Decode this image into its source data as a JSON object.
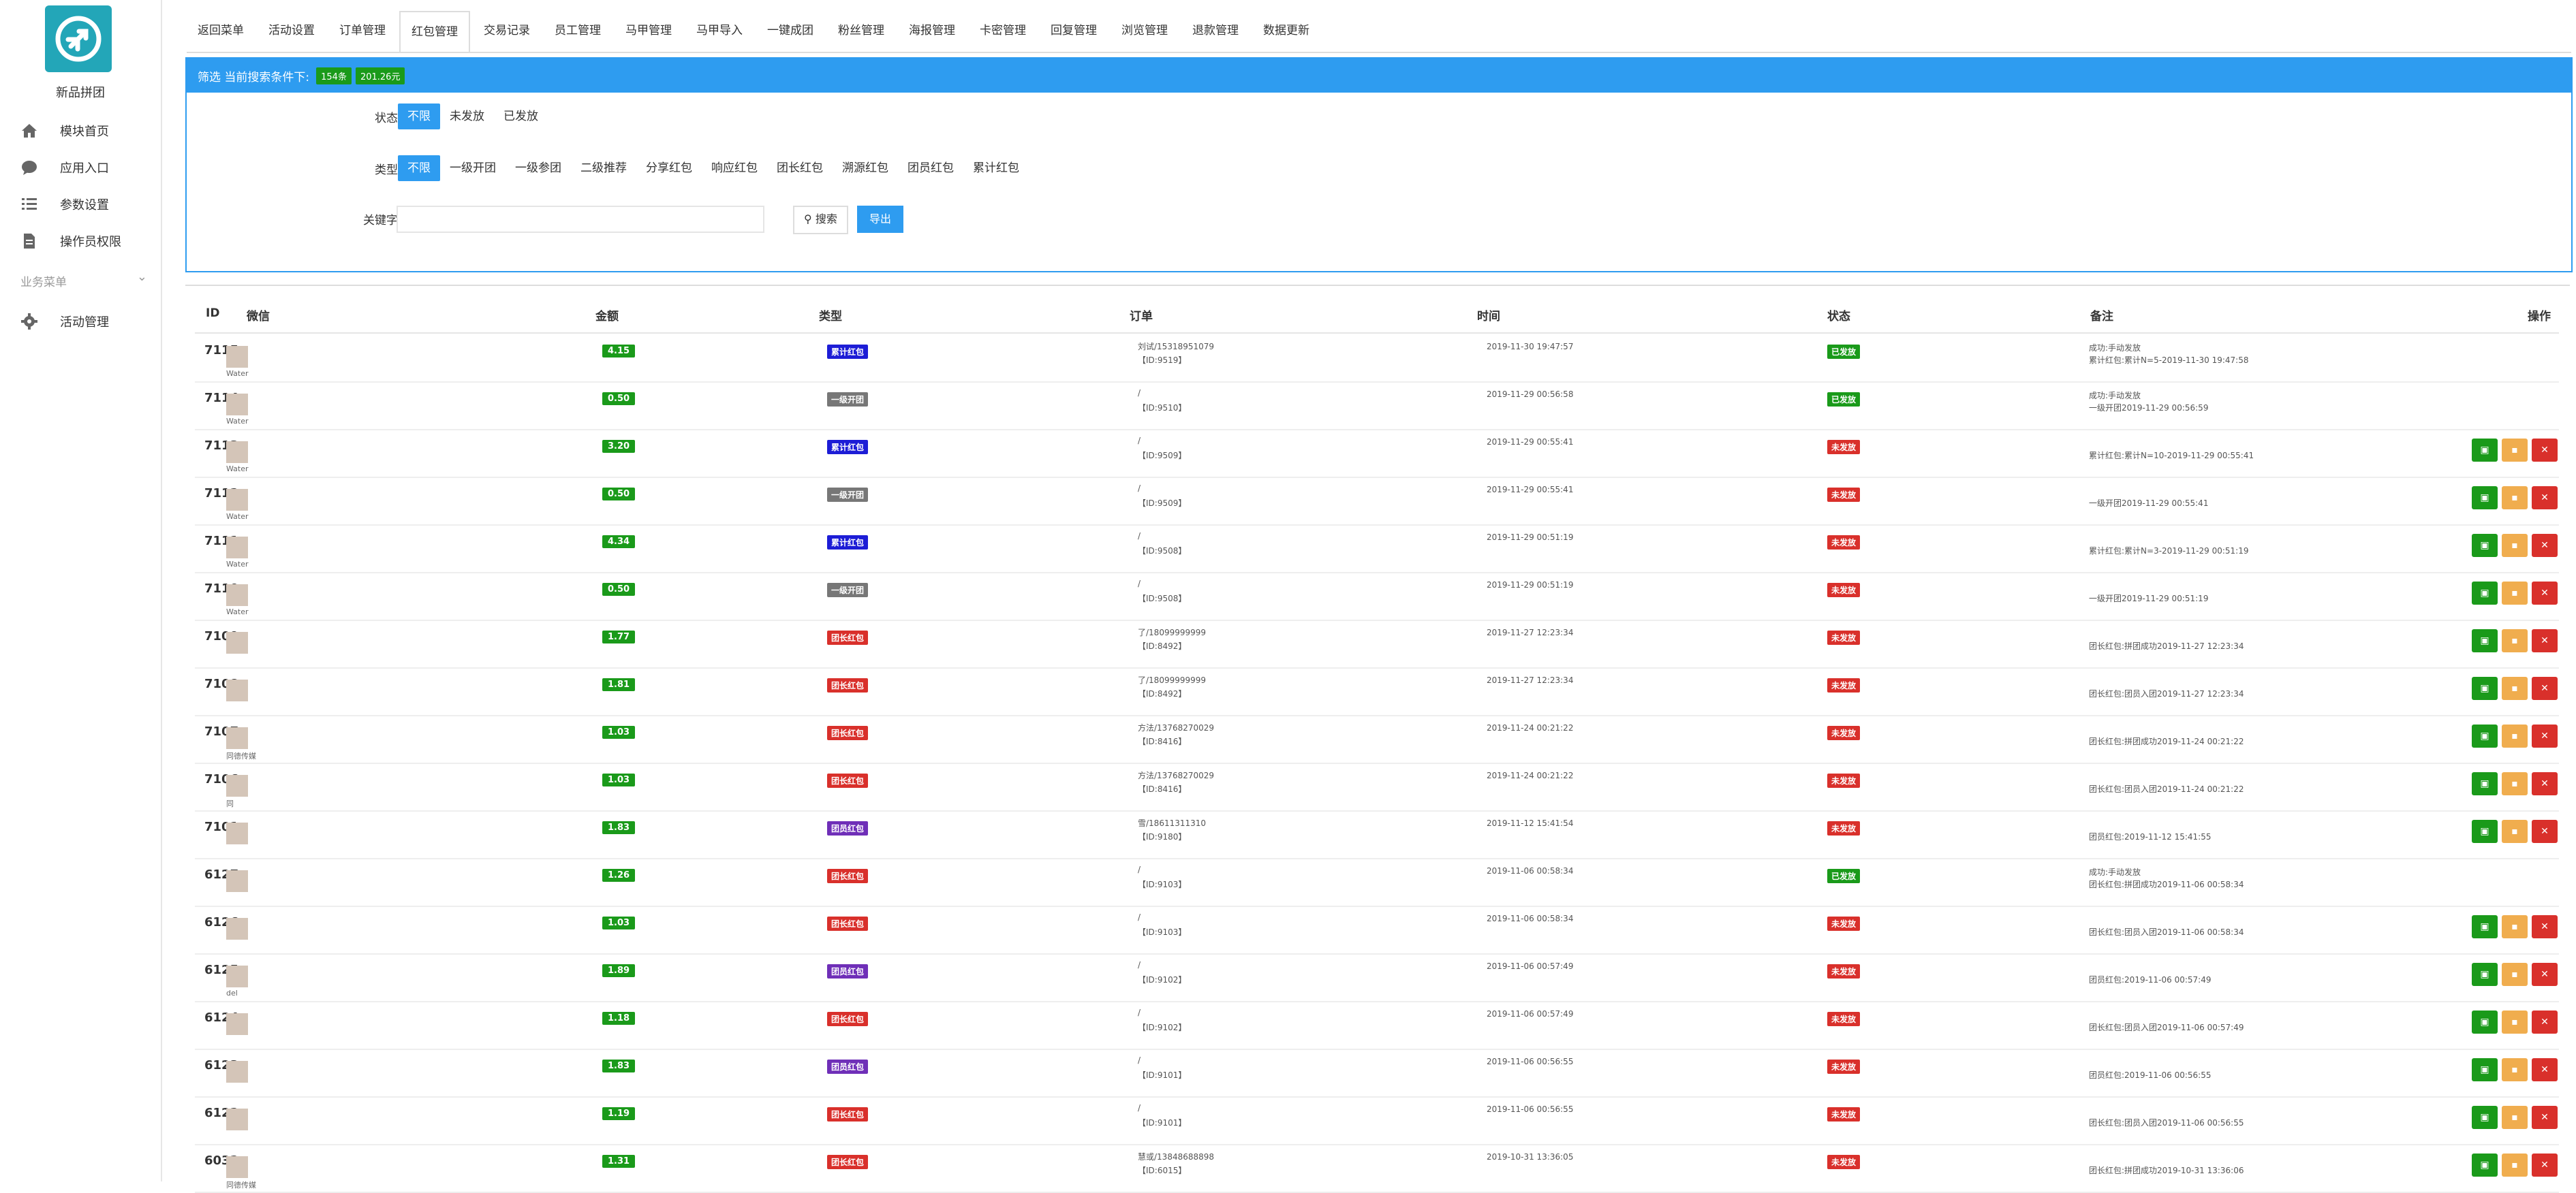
{
  "sidebar": {
    "brand": "新品拼团",
    "items": [
      {
        "label": "模块首页",
        "icon": "home-icon"
      },
      {
        "label": "应用入口",
        "icon": "chat-icon"
      },
      {
        "label": "参数设置",
        "icon": "list-icon"
      },
      {
        "label": "操作员权限",
        "icon": "document-icon"
      }
    ],
    "group_label": "业务菜单",
    "group_items": [
      {
        "label": "活动管理",
        "icon": "gear-icon"
      }
    ]
  },
  "tabs": [
    "返回菜单",
    "活动设置",
    "订单管理",
    "红包管理",
    "交易记录",
    "员工管理",
    "马甲管理",
    "马甲导入",
    "一键成团",
    "粉丝管理",
    "海报管理",
    "卡密管理",
    "回复管理",
    "浏览管理",
    "退款管理",
    "数据更新"
  ],
  "active_tab": "红包管理",
  "filter": {
    "header": "筛选 当前搜索条件下:",
    "count_badge": "154条",
    "sum_badge": "201.26元",
    "status_label": "状态",
    "status_options": [
      "不限",
      "未发放",
      "已发放"
    ],
    "type_label": "类型",
    "type_options": [
      "不限",
      "一级开团",
      "一级参团",
      "二级推荐",
      "分享红包",
      "响应红包",
      "团长红包",
      "溯源红包",
      "团员红包",
      "累计红包"
    ],
    "keyword_label": "关键字",
    "keyword_value": "",
    "search_label": "搜索",
    "export_label": "导出"
  },
  "table": {
    "headers": [
      "ID",
      "微信",
      "金额",
      "类型",
      "订单",
      "时间",
      "状态",
      "备注",
      "操作"
    ],
    "rows": [
      {
        "id": "7115",
        "nick": "Water",
        "amount": "4.15",
        "type": "累计红包",
        "type_color": "#1d1dd6",
        "order1": "刘试/15318951079",
        "order2": "【ID:9519】",
        "time": "2019-11-30 19:47:57",
        "status": "已发放",
        "status_color": "#1a9a1a",
        "note1": "成功:手动发放",
        "note2": "累计红包:累计N=5-2019-11-30 19:47:58",
        "actions": false
      },
      {
        "id": "7114",
        "nick": "Water",
        "amount": "0.50",
        "type": "一级开团",
        "type_color": "#777777",
        "order1": "/",
        "order2": "【ID:9510】",
        "time": "2019-11-29 00:56:58",
        "status": "已发放",
        "status_color": "#1a9a1a",
        "note1": "成功:手动发放",
        "note2": "一级开团2019-11-29 00:56:59",
        "actions": false
      },
      {
        "id": "7113",
        "nick": "Water",
        "amount": "3.20",
        "type": "累计红包",
        "type_color": "#1d1dd6",
        "order1": "/",
        "order2": "【ID:9509】",
        "time": "2019-11-29 00:55:41",
        "status": "未发放",
        "status_color": "#d9302b",
        "note1": "",
        "note2": "累计红包:累计N=10-2019-11-29 00:55:41",
        "actions": true
      },
      {
        "id": "7112",
        "nick": "Water",
        "amount": "0.50",
        "type": "一级开团",
        "type_color": "#777777",
        "order1": "/",
        "order2": "【ID:9509】",
        "time": "2019-11-29 00:55:41",
        "status": "未发放",
        "status_color": "#d9302b",
        "note1": "",
        "note2": "一级开团2019-11-29 00:55:41",
        "actions": true
      },
      {
        "id": "7111",
        "nick": "Water",
        "amount": "4.34",
        "type": "累计红包",
        "type_color": "#1d1dd6",
        "order1": "/",
        "order2": "【ID:9508】",
        "time": "2019-11-29 00:51:19",
        "status": "未发放",
        "status_color": "#d9302b",
        "note1": "",
        "note2": "累计红包:累计N=3-2019-11-29 00:51:19",
        "actions": true
      },
      {
        "id": "7110",
        "nick": "Water",
        "amount": "0.50",
        "type": "一级开团",
        "type_color": "#777777",
        "order1": "/",
        "order2": "【ID:9508】",
        "time": "2019-11-29 00:51:19",
        "status": "未发放",
        "status_color": "#d9302b",
        "note1": "",
        "note2": "一级开团2019-11-29 00:51:19",
        "actions": true
      },
      {
        "id": "7109",
        "nick": "",
        "amount": "1.77",
        "type": "团长红包",
        "type_color": "#d9302b",
        "order1": "了/18099999999",
        "order2": "【ID:8492】",
        "time": "2019-11-27 12:23:34",
        "status": "未发放",
        "status_color": "#d9302b",
        "note1": "",
        "note2": "团长红包:拼团成功2019-11-27 12:23:34",
        "actions": true
      },
      {
        "id": "7108",
        "nick": "",
        "amount": "1.81",
        "type": "团长红包",
        "type_color": "#d9302b",
        "order1": "了/18099999999",
        "order2": "【ID:8492】",
        "time": "2019-11-27 12:23:34",
        "status": "未发放",
        "status_color": "#d9302b",
        "note1": "",
        "note2": "团长红包:团员入团2019-11-27 12:23:34",
        "actions": true
      },
      {
        "id": "7107",
        "nick": "同德传媒",
        "amount": "1.03",
        "type": "团长红包",
        "type_color": "#d9302b",
        "order1": "方法/13768270029",
        "order2": "【ID:8416】",
        "time": "2019-11-24 00:21:22",
        "status": "未发放",
        "status_color": "#d9302b",
        "note1": "",
        "note2": "团长红包:拼团成功2019-11-24 00:21:22",
        "actions": true
      },
      {
        "id": "7106",
        "nick": "同",
        "amount": "1.03",
        "type": "团长红包",
        "type_color": "#d9302b",
        "order1": "方法/13768270029",
        "order2": "【ID:8416】",
        "time": "2019-11-24 00:21:22",
        "status": "未发放",
        "status_color": "#d9302b",
        "note1": "",
        "note2": "团长红包:团员入团2019-11-24 00:21:22",
        "actions": true
      },
      {
        "id": "7101",
        "nick": "",
        "amount": "1.83",
        "type": "团员红包",
        "type_color": "#6f2fb8",
        "order1": "雪/18611311310",
        "order2": "【ID:9180】",
        "time": "2019-11-12 15:41:54",
        "status": "未发放",
        "status_color": "#d9302b",
        "note1": "",
        "note2": "团员红包:2019-11-12 15:41:55",
        "actions": true
      },
      {
        "id": "6127",
        "nick": "",
        "amount": "1.26",
        "type": "团长红包",
        "type_color": "#d9302b",
        "order1": "/",
        "order2": "【ID:9103】",
        "time": "2019-11-06 00:58:34",
        "status": "已发放",
        "status_color": "#1a9a1a",
        "note1": "成功:手动发放",
        "note2": "团长红包:拼团成功2019-11-06 00:58:34",
        "actions": false
      },
      {
        "id": "6126",
        "nick": "",
        "amount": "1.03",
        "type": "团长红包",
        "type_color": "#d9302b",
        "order1": "/",
        "order2": "【ID:9103】",
        "time": "2019-11-06 00:58:34",
        "status": "未发放",
        "status_color": "#d9302b",
        "note1": "",
        "note2": "团长红包:团员入团2019-11-06 00:58:34",
        "actions": true
      },
      {
        "id": "6125",
        "nick": "del",
        "amount": "1.89",
        "type": "团员红包",
        "type_color": "#6f2fb8",
        "order1": "/",
        "order2": "【ID:9102】",
        "time": "2019-11-06 00:57:49",
        "status": "未发放",
        "status_color": "#d9302b",
        "note1": "",
        "note2": "团员红包:2019-11-06 00:57:49",
        "actions": true
      },
      {
        "id": "6124",
        "nick": "",
        "amount": "1.18",
        "type": "团长红包",
        "type_color": "#d9302b",
        "order1": "/",
        "order2": "【ID:9102】",
        "time": "2019-11-06 00:57:49",
        "status": "未发放",
        "status_color": "#d9302b",
        "note1": "",
        "note2": "团长红包:团员入团2019-11-06 00:57:49",
        "actions": true
      },
      {
        "id": "6123",
        "nick": "",
        "amount": "1.83",
        "type": "团员红包",
        "type_color": "#6f2fb8",
        "order1": "/",
        "order2": "【ID:9101】",
        "time": "2019-11-06 00:56:55",
        "status": "未发放",
        "status_color": "#d9302b",
        "note1": "",
        "note2": "团员红包:2019-11-06 00:56:55",
        "actions": true
      },
      {
        "id": "6122",
        "nick": "",
        "amount": "1.19",
        "type": "团长红包",
        "type_color": "#d9302b",
        "order1": "/",
        "order2": "【ID:9101】",
        "time": "2019-11-06 00:56:55",
        "status": "未发放",
        "status_color": "#d9302b",
        "note1": "",
        "note2": "团长红包:团员入团2019-11-06 00:56:55",
        "actions": true
      },
      {
        "id": "6032",
        "nick": "同德传媒",
        "amount": "1.31",
        "type": "团长红包",
        "type_color": "#d9302b",
        "order1": "慧或/13848688898",
        "order2": "【ID:6015】",
        "time": "2019-10-31 13:36:05",
        "status": "未发放",
        "status_color": "#d9302b",
        "note1": "",
        "note2": "团长红包:拼团成功2019-10-31 13:36:06",
        "actions": true
      }
    ]
  },
  "colors": {
    "accent": "#2e9cf0",
    "green": "#1a9a1a",
    "red": "#d9302b",
    "orange": "#f0ad4e",
    "logo_teal": "#23a6b8"
  }
}
